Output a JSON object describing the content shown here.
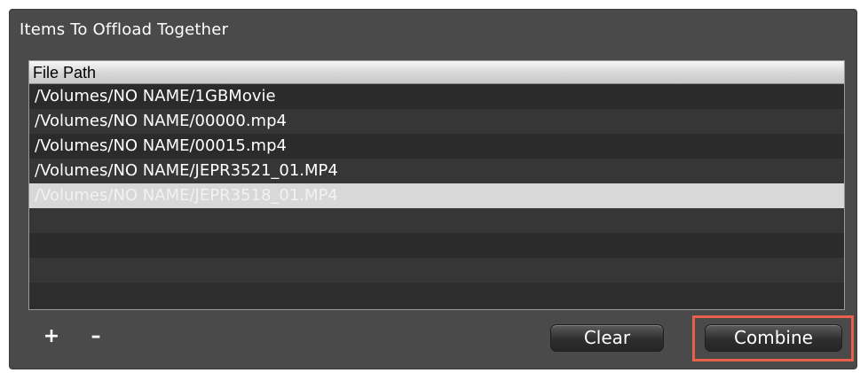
{
  "panel": {
    "title": "Items To Offload Together"
  },
  "table": {
    "column_header": "File Path",
    "rows": [
      {
        "path": "/Volumes/NO NAME/1GBMovie",
        "selected": false
      },
      {
        "path": "/Volumes/NO NAME/00000.mp4",
        "selected": false
      },
      {
        "path": "/Volumes/NO NAME/00015.mp4",
        "selected": false
      },
      {
        "path": "/Volumes/NO NAME/JEPR3521_01.MP4",
        "selected": false
      },
      {
        "path": "/Volumes/NO NAME/JEPR3518_01.MP4",
        "selected": true
      }
    ]
  },
  "controls": {
    "add_label": "+",
    "remove_label": "–",
    "clear_label": "Clear",
    "combine_label": "Combine"
  },
  "colors": {
    "panel_bg": "#4a4a4a",
    "highlight": "#e8604a",
    "selected_row": "#d8d8d8"
  }
}
